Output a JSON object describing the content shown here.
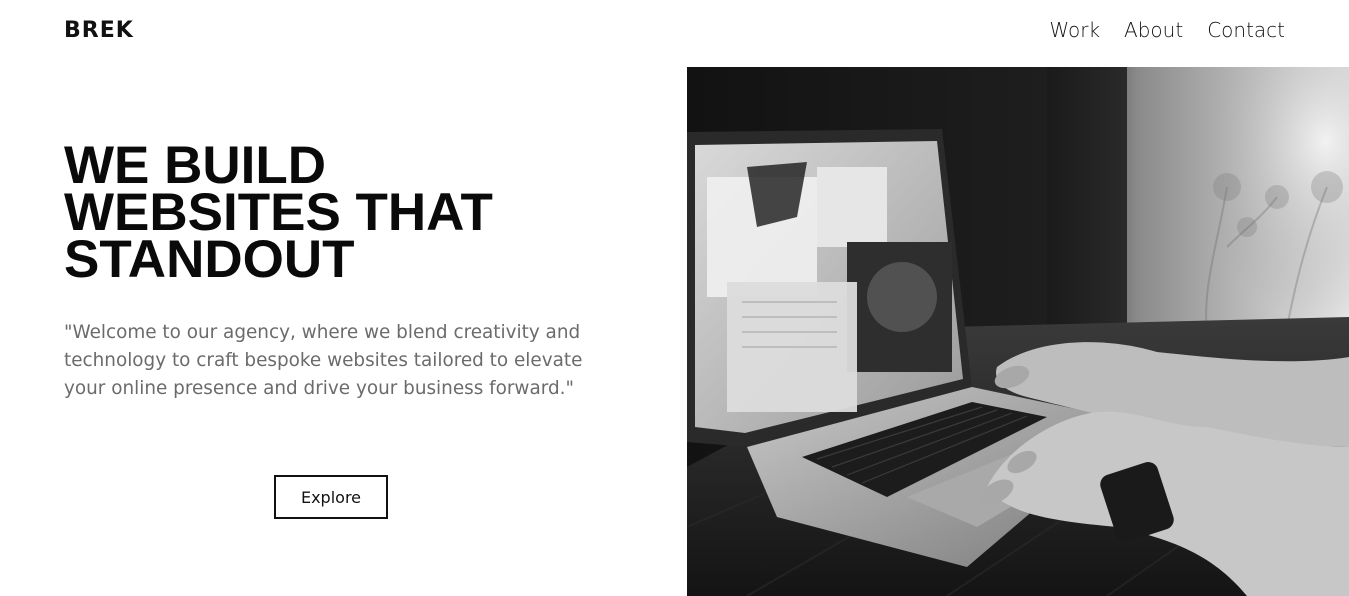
{
  "header": {
    "logo": "BREK",
    "nav": [
      {
        "label": "Work"
      },
      {
        "label": "About"
      },
      {
        "label": "Contact"
      }
    ]
  },
  "hero": {
    "title_lines": [
      "WE BUILD",
      "WEBSITES THAT",
      "STANDOUT"
    ],
    "description": "\"Welcome to our agency, where we blend creativity and technology to craft bespoke websites tailored to elevate your online presence and drive your business forward.\"",
    "cta_label": "Explore",
    "image": {
      "subject": "laptop-typing-photo",
      "tone": "grayscale"
    }
  },
  "colors": {
    "text": "#0a0a0a",
    "muted": "#6b6b6b",
    "background": "#ffffff"
  }
}
